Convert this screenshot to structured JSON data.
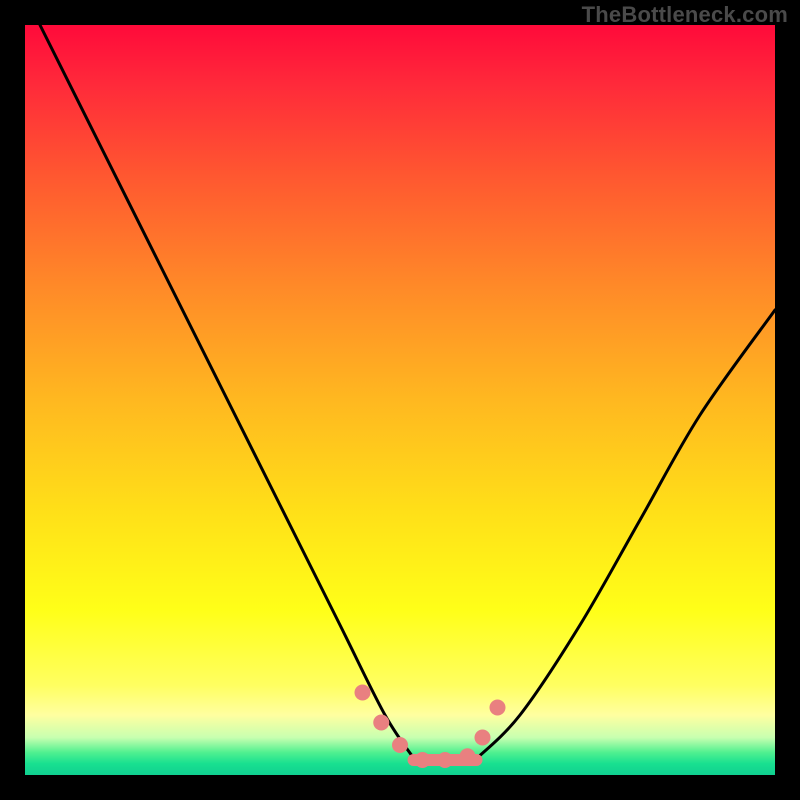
{
  "attribution": "TheBottleneck.com",
  "colors": {
    "frame_bg_top": "#ff0a3a",
    "frame_bg_bottom": "#10d090",
    "curve": "#000000",
    "marker": "#e98080",
    "page_bg": "#000000",
    "attribution_text": "#4a4a4a"
  },
  "chart_data": {
    "type": "line",
    "title": "",
    "xlabel": "",
    "ylabel": "",
    "xlim": [
      0,
      100
    ],
    "ylim": [
      0,
      100
    ],
    "grid": false,
    "series": [
      {
        "name": "left-curve",
        "x": [
          2,
          10,
          18,
          26,
          34,
          42,
          48,
          52
        ],
        "values": [
          100,
          84,
          68,
          52,
          36,
          20,
          8,
          2
        ]
      },
      {
        "name": "right-curve",
        "x": [
          60,
          66,
          74,
          82,
          90,
          100
        ],
        "values": [
          2,
          8,
          20,
          34,
          48,
          62
        ]
      },
      {
        "name": "floor",
        "x": [
          52,
          55,
          58,
          60
        ],
        "values": [
          2,
          1.5,
          1.5,
          2
        ]
      }
    ],
    "markers": {
      "name": "highlight-points",
      "x": [
        45,
        47.5,
        50,
        53,
        56,
        59,
        61,
        63
      ],
      "values": [
        11,
        7,
        4,
        2,
        2,
        2.5,
        5,
        9
      ]
    },
    "floor_bar": {
      "x_start": 51,
      "x_end": 61,
      "y": 2,
      "height": 1.6
    }
  }
}
